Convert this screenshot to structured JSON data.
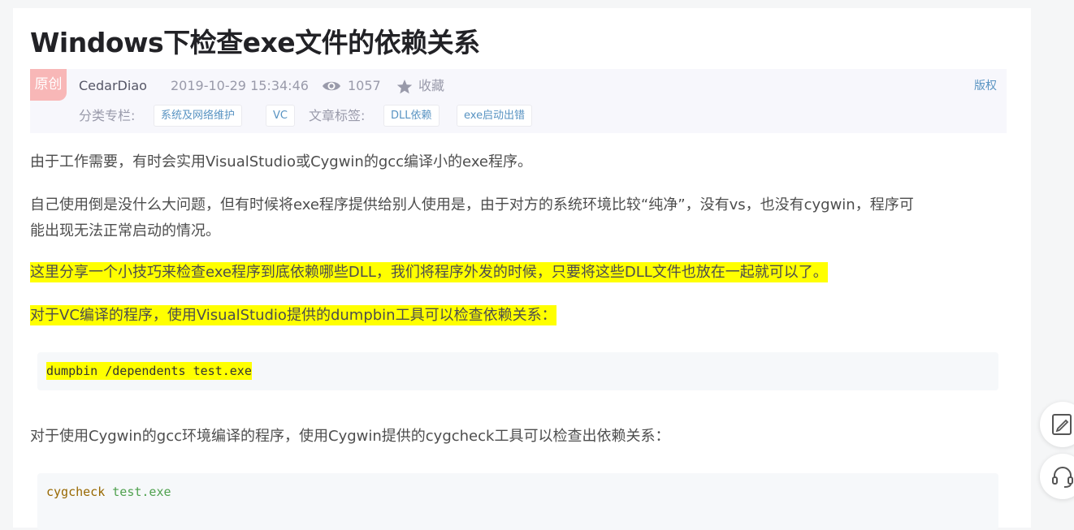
{
  "article": {
    "title": "Windows下检查exe文件的依赖关系",
    "badge": "原创",
    "author": "CedarDiao",
    "date": "2019-10-29 15:34:46",
    "views": "1057",
    "collect": "收藏",
    "copyright": "版权",
    "category_label": "分类专栏:",
    "categories": [
      "系统及网络维护",
      "VC"
    ],
    "tags_label": "文章标签:",
    "tags": [
      "DLL依赖",
      "exe启动出错"
    ]
  },
  "content": {
    "p1": "由于工作需要，有时会实用VisualStudio或Cygwin的gcc编译小的exe程序。",
    "p2_line1": "自己使用倒是没什么大问题，但有时候将exe程序提供给别人使用是，由于对方的系统环境比较“纯净”，没有vs，也没有cygwin，程序可",
    "p2_line2": "能出现无法正常启动的情况。",
    "p3": "这里分享一个小技巧来检查exe程序到底依赖哪些DLL，我们将程序外发的时候，只要将这些DLL文件也放在一起就可以了。",
    "p4": "对于VC编译的程序，使用VisualStudio提供的dumpbin工具可以检查依赖关系：",
    "code1": "dumpbin /dependents test.exe",
    "p5": "对于使用Cygwin的gcc环境编译的程序，使用Cygwin提供的cygcheck工具可以检查出依赖关系：",
    "code2_cmd": "cygcheck",
    "code2_arg": "test.exe"
  },
  "icons": {
    "views": "eye-icon",
    "collect": "star-icon",
    "float1": "edit-icon",
    "float2": "headset-icon"
  },
  "colors": {
    "highlight": "#ffff00",
    "link": "#5893c2",
    "badge": "#f8b7b7"
  }
}
